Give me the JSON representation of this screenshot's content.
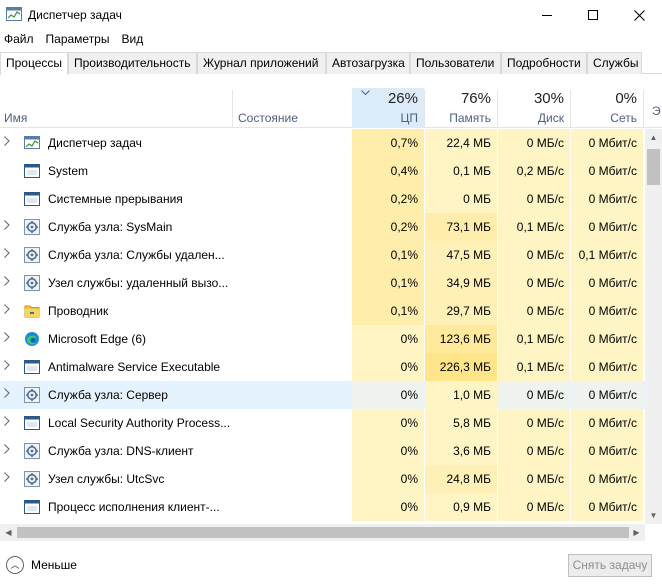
{
  "window": {
    "title": "Диспетчер задач"
  },
  "menu": [
    "Файл",
    "Параметры",
    "Вид"
  ],
  "tabs": [
    "Процессы",
    "Производительность",
    "Журнал приложений",
    "Автозагрузка",
    "Пользователи",
    "Подробности",
    "Службы"
  ],
  "header": {
    "name": "Имя",
    "status": "Состояние",
    "cpu_pct": "26%",
    "cpu": "ЦП",
    "mem_pct": "76%",
    "mem": "Память",
    "disk_pct": "30%",
    "disk": "Диск",
    "net_pct": "0%",
    "net": "Сеть",
    "extra": "Э"
  },
  "processes": [
    {
      "name": "Диспетчер задач",
      "expandable": true,
      "icon": "taskmgr-icon",
      "cpu": "0,7%",
      "mem": "22,4 МБ",
      "disk": "0 МБ/с",
      "net": "0 Мбит/с",
      "mem_heat": "#fff4c4"
    },
    {
      "name": "System",
      "expandable": false,
      "icon": "window-icon",
      "cpu": "0,4%",
      "mem": "0,1 МБ",
      "disk": "0,2 МБ/с",
      "net": "0 Мбит/с",
      "mem_heat": "#fff4c4"
    },
    {
      "name": "Системные прерывания",
      "expandable": false,
      "icon": "window-icon",
      "cpu": "0,2%",
      "mem": "0 МБ",
      "disk": "0 МБ/с",
      "net": "0 Мбит/с",
      "mem_heat": "#fff4c4"
    },
    {
      "name": "Служба узла: SysMain",
      "expandable": true,
      "icon": "gear-icon",
      "cpu": "0,2%",
      "mem": "73,1 МБ",
      "disk": "0,1 МБ/с",
      "net": "0 Мбит/с",
      "mem_heat": "#ffeeab"
    },
    {
      "name": "Служба узла: Службы удален...",
      "expandable": true,
      "icon": "gear-icon",
      "cpu": "0,1%",
      "mem": "47,5 МБ",
      "disk": "0 МБ/с",
      "net": "0,1 Мбит/с",
      "mem_heat": "#fff0b8"
    },
    {
      "name": "Узел службы: удаленный вызо...",
      "expandable": true,
      "icon": "gear-icon",
      "cpu": "0,1%",
      "mem": "34,9 МБ",
      "disk": "0 МБ/с",
      "net": "0 Мбит/с",
      "mem_heat": "#fff0b8"
    },
    {
      "name": "Проводник",
      "expandable": true,
      "icon": "folder-icon",
      "cpu": "0,1%",
      "mem": "29,7 МБ",
      "disk": "0 МБ/с",
      "net": "0 Мбит/с",
      "mem_heat": "#fff0b8"
    },
    {
      "name": "Microsoft Edge (6)",
      "expandable": true,
      "icon": "edge-icon",
      "cpu": "0%",
      "mem": "123,6 МБ",
      "disk": "0,1 МБ/с",
      "net": "0 Мбит/с",
      "mem_heat": "#ffe99a"
    },
    {
      "name": "Antimalware Service Executable",
      "expandable": true,
      "icon": "window-icon",
      "cpu": "0%",
      "mem": "226,3 МБ",
      "disk": "0,1 МБ/с",
      "net": "0 Мбит/с",
      "mem_heat": "#ffe58a"
    },
    {
      "name": "Служба узла: Сервер",
      "expandable": true,
      "icon": "gear-icon",
      "cpu": "0%",
      "mem": "1,0 МБ",
      "disk": "0 МБ/с",
      "net": "0 Мбит/с",
      "mem_heat": "#fff4c4"
    },
    {
      "name": "Local Security Authority Process...",
      "expandable": true,
      "icon": "window-icon",
      "cpu": "0%",
      "mem": "5,8 МБ",
      "disk": "0 МБ/с",
      "net": "0 Мбит/с",
      "mem_heat": "#fff4c4"
    },
    {
      "name": "Служба узла: DNS-клиент",
      "expandable": true,
      "icon": "gear-icon",
      "cpu": "0%",
      "mem": "3,6 МБ",
      "disk": "0 МБ/с",
      "net": "0 Мбит/с",
      "mem_heat": "#fff4c4"
    },
    {
      "name": "Узел службы: UtcSvc",
      "expandable": true,
      "icon": "gear-icon",
      "cpu": "0%",
      "mem": "24,8 МБ",
      "disk": "0 МБ/с",
      "net": "0 Мбит/с",
      "mem_heat": "#fff0b8"
    },
    {
      "name": "Процесс исполнения клиент-...",
      "expandable": false,
      "icon": "window-icon",
      "cpu": "0%",
      "mem": "0,9 МБ",
      "disk": "0 МБ/с",
      "net": "0 Мбит/с",
      "mem_heat": "#fff4c4"
    }
  ],
  "hover_row": 9,
  "footer": {
    "less": "Меньше",
    "end_task": "Снять задачу"
  },
  "colors": {
    "cpu_header": "#dcebf8",
    "cell_heat": "#fff4c4",
    "hover": "#e5f3ff"
  }
}
